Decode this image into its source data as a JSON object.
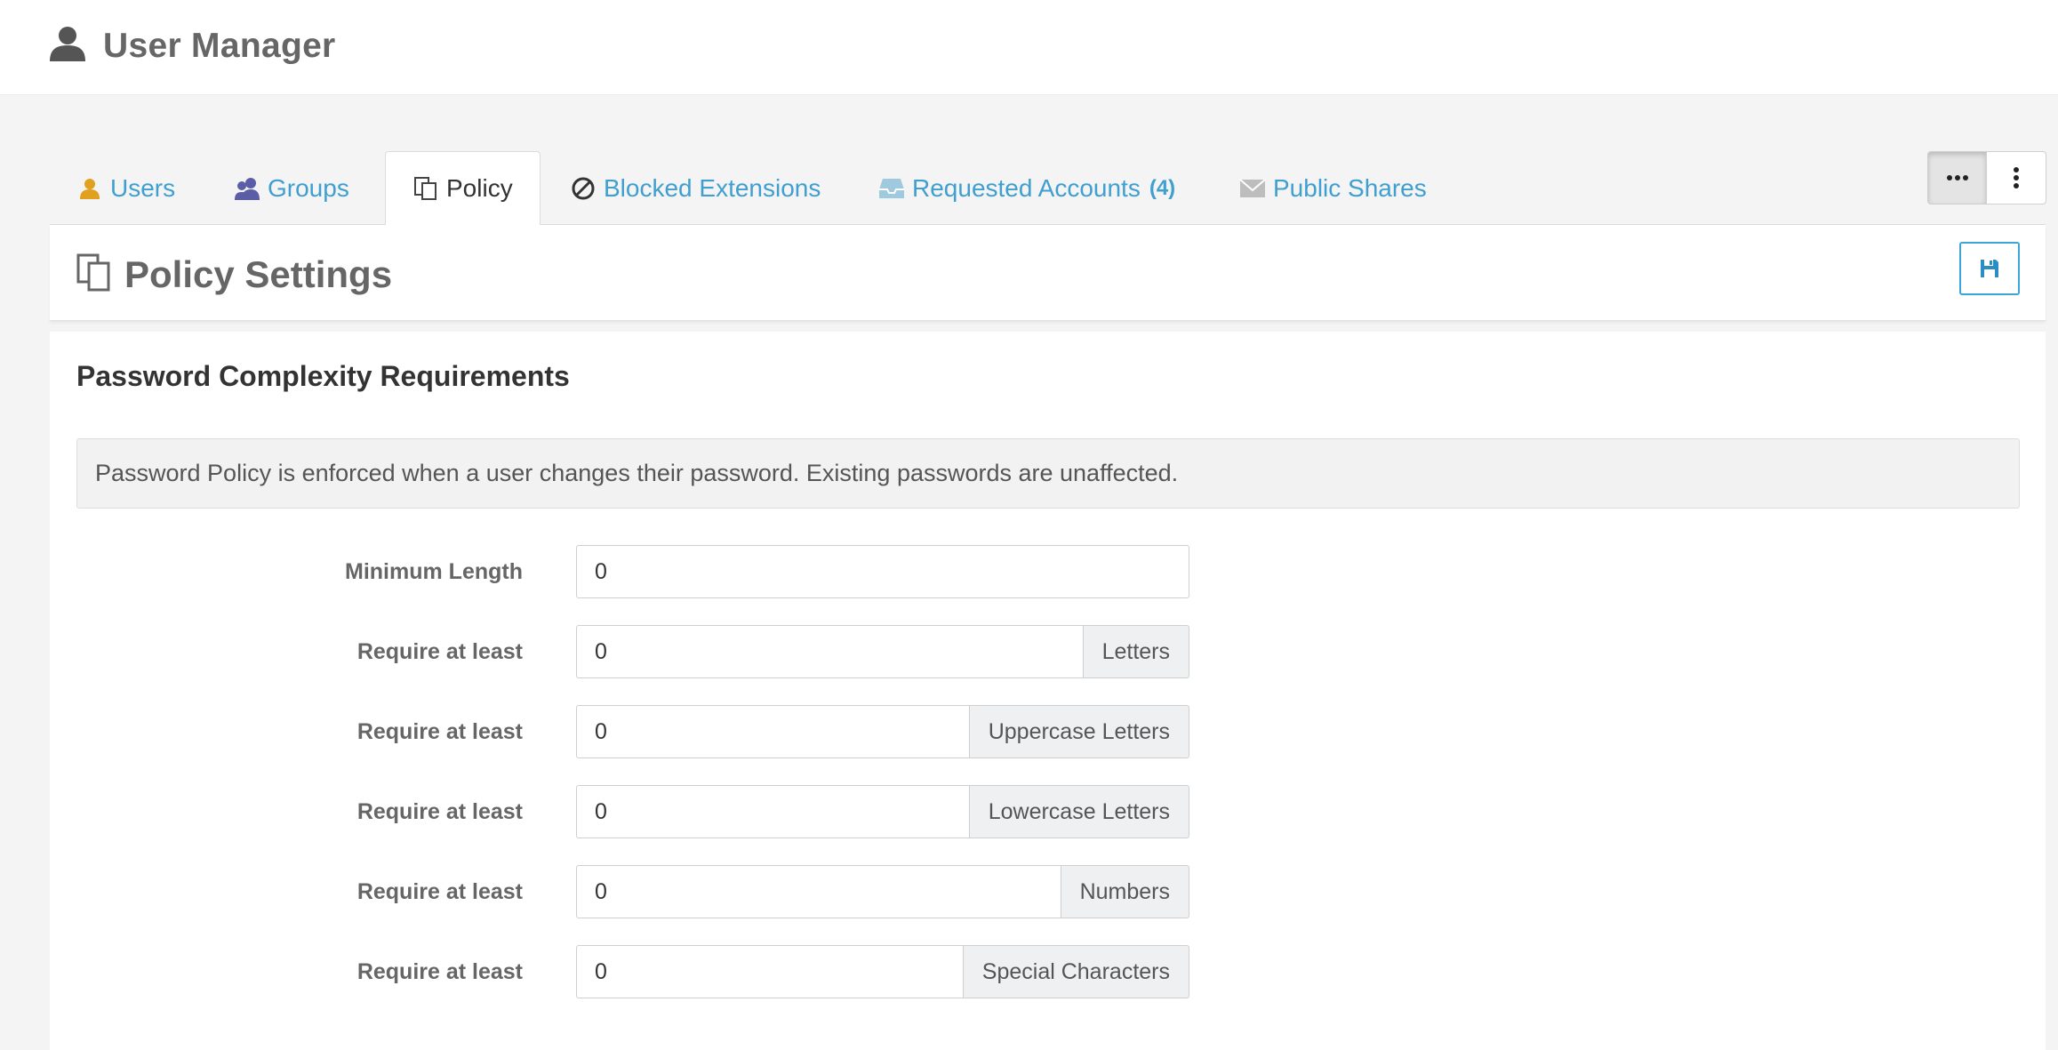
{
  "app": {
    "title": "User Manager",
    "icon": "user-icon"
  },
  "tabs": [
    {
      "label": "Users",
      "icon": "user-icon",
      "color": "#e0a020"
    },
    {
      "label": "Groups",
      "icon": "users-group-icon",
      "color": "#5b5ea6"
    },
    {
      "label": "Policy",
      "icon": "copy-icon",
      "active": true
    },
    {
      "label": "Blocked Extensions",
      "icon": "ban-icon"
    },
    {
      "label": "Requested  Accounts",
      "count": "(4)",
      "icon": "inbox-icon"
    },
    {
      "label": "Public Shares",
      "icon": "envelope-icon"
    }
  ],
  "toolbar": {
    "more_icon": "ellipsis-horizontal-icon",
    "menu_icon": "ellipsis-vertical-icon"
  },
  "panel": {
    "title": "Policy Settings",
    "icon": "copy-icon",
    "save_icon": "floppy-disk-icon"
  },
  "section": {
    "title": "Password Complexity Requirements",
    "info": "Password Policy is enforced when a user changes their password. Existing passwords are unaffected."
  },
  "fields": [
    {
      "label": "Minimum Length",
      "value": "0",
      "addon": ""
    },
    {
      "label": "Require at least",
      "value": "0",
      "addon": "Letters"
    },
    {
      "label": "Require at least",
      "value": "0",
      "addon": "Uppercase Letters"
    },
    {
      "label": "Require at least",
      "value": "0",
      "addon": "Lowercase Letters"
    },
    {
      "label": "Require at least",
      "value": "0",
      "addon": "Numbers"
    },
    {
      "label": "Require at least",
      "value": "0",
      "addon": "Special Characters"
    }
  ],
  "colors": {
    "accent": "#3f9fd0",
    "users_icon": "#e0a020",
    "groups_icon": "#5b5ea6"
  }
}
